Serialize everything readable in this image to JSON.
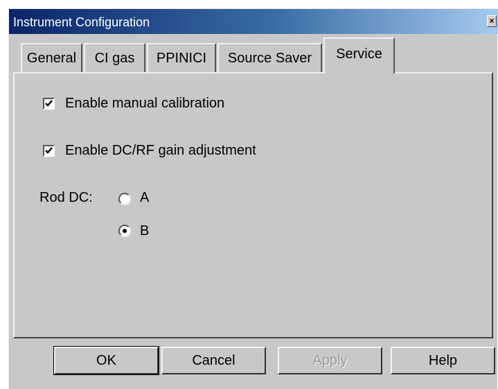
{
  "window": {
    "title": "Instrument Configuration",
    "close_glyph": "×"
  },
  "tabs": [
    {
      "label": "General",
      "active": false
    },
    {
      "label": "CI gas",
      "active": false
    },
    {
      "label": "PPINICI",
      "active": false
    },
    {
      "label": "Source Saver",
      "active": false
    },
    {
      "label": "Service",
      "active": true
    }
  ],
  "service": {
    "manual_calibration": {
      "label": "Enable manual calibration",
      "checked": true
    },
    "dcrf_gain": {
      "label": "Enable DC/RF gain adjustment",
      "checked": true
    },
    "rod_dc": {
      "label": "Rod DC:",
      "options": [
        {
          "label": "A",
          "selected": false
        },
        {
          "label": "B",
          "selected": true
        }
      ]
    }
  },
  "buttons": {
    "ok": "OK",
    "cancel": "Cancel",
    "apply": "Apply",
    "help": "Help"
  },
  "icons": {
    "check": "check-icon",
    "close": "close-icon"
  }
}
